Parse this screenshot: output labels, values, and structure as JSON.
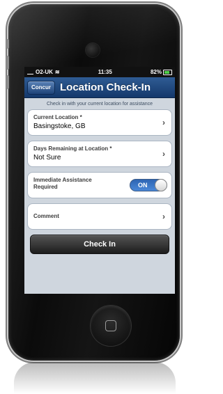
{
  "status_bar": {
    "carrier": "O2-UK",
    "time": "11:35",
    "battery": "82%"
  },
  "nav": {
    "brand_label": "Concur",
    "title": "Location Check-In"
  },
  "instruction": "Check in with your current location for assistance",
  "current_location": {
    "label": "Current Location *",
    "value": "Basingstoke, GB"
  },
  "days_remaining": {
    "label": "Days Remaining at Location *",
    "value": "Not Sure"
  },
  "assistance": {
    "label": "Immediate Assistance Required",
    "toggle_label": "ON",
    "toggle_state": true
  },
  "comment": {
    "label": "Comment"
  },
  "check_in_button": "Check In",
  "icons": {
    "chevron": "chevron-right-icon",
    "wifi": "wifi-icon",
    "battery": "battery-icon",
    "signal": "signal-icon"
  },
  "colors": {
    "nav_bar": "#1f4a82",
    "toggle_on": "#3b7ad0",
    "button": "#2a2a2a"
  }
}
